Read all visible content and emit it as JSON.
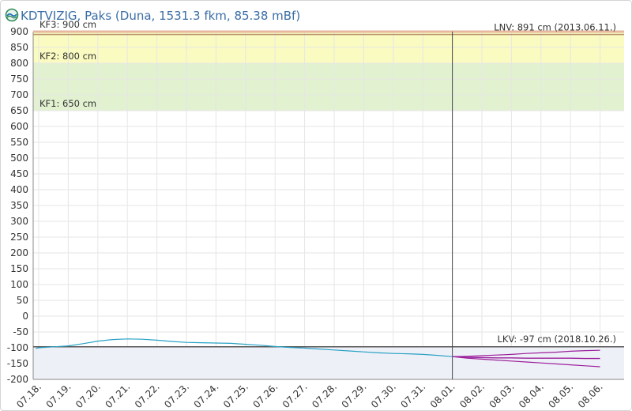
{
  "header": {
    "title": "KDTVIZIG, Paks (Duna, 1531.3 fkm, 85.38 mBf)"
  },
  "colors": {
    "kf3_band": "#f3d9c9",
    "kf2_band": "#fafbc0",
    "kf1_band": "#e2f1cf",
    "lnv_line": "#b8906a",
    "lkv_line": "#555555",
    "lkv_fill": "#eef0f8",
    "observed_line": "#27a2c4",
    "forecast_line": "#9b1f9b",
    "grid": "#e6e6e6",
    "title": "#3a6ea5"
  },
  "chart_data": {
    "type": "line",
    "ylim": [
      -200,
      900
    ],
    "ytick_step": 50,
    "yticks": [
      "900",
      "850",
      "800",
      "750",
      "700",
      "650",
      "600",
      "550",
      "500",
      "450",
      "400",
      "350",
      "300",
      "250",
      "200",
      "150",
      "100",
      "50",
      "0",
      "-50",
      "-100",
      "-150",
      "-200"
    ],
    "categories": [
      "07.18.",
      "07.19.",
      "07.20.",
      "07.21.",
      "07.22.",
      "07.23.",
      "07.24.",
      "07.25.",
      "07.26.",
      "07.27.",
      "07.28.",
      "07.29.",
      "07.30.",
      "07.31.",
      "08.01.",
      "08.02.",
      "08.03.",
      "08.04.",
      "08.05.",
      "08.06."
    ],
    "forecast_start_index": 14,
    "thresholds": [
      {
        "label": "KF1: 650 cm",
        "value": 650
      },
      {
        "label": "KF2: 800 cm",
        "value": 800
      },
      {
        "label": "KF3: 900 cm",
        "value": 900
      }
    ],
    "lnv": {
      "label": "LNV: 891 cm (2013.06.11.)",
      "value": 891
    },
    "lkv": {
      "label": "LKV: -97 cm (2018.10.26.)",
      "value": -97
    },
    "series": [
      {
        "kind": "observed",
        "x": [
          -0.1,
          0.0,
          0.5,
          1.0,
          1.5,
          2.0,
          2.5,
          3.0,
          3.5,
          4.0,
          4.5,
          5.0,
          5.5,
          6.0,
          6.5,
          7.0,
          7.5,
          8.0,
          8.5,
          9.0,
          9.5,
          10.0,
          10.5,
          11.0,
          11.5,
          12.0,
          12.5,
          13.0,
          13.5,
          14.0
        ],
        "values": [
          -102,
          -100,
          -97,
          -94,
          -87,
          -79,
          -74,
          -72,
          -73,
          -76,
          -80,
          -83,
          -84,
          -85,
          -86,
          -89,
          -92,
          -96,
          -99,
          -101,
          -104,
          -107,
          -110,
          -113,
          -116,
          -118,
          -119,
          -121,
          -124,
          -128
        ]
      },
      {
        "kind": "forecast-mid",
        "x": [
          14.0,
          14.5,
          15.0,
          15.5,
          16.0,
          16.5,
          17.0,
          17.5,
          18.0,
          18.5,
          19.0
        ],
        "values": [
          -128,
          -130,
          -131,
          -132,
          -132,
          -133,
          -133,
          -133,
          -133,
          -134,
          -134
        ]
      },
      {
        "kind": "forecast-upper",
        "x": [
          14.0,
          14.5,
          15.0,
          15.5,
          16.0,
          16.5,
          17.0,
          17.5,
          18.0,
          18.5,
          19.0
        ],
        "values": [
          -128,
          -127,
          -125,
          -123,
          -121,
          -118,
          -116,
          -114,
          -111,
          -109,
          -108
        ]
      },
      {
        "kind": "forecast-lower",
        "x": [
          14.0,
          14.5,
          15.0,
          15.5,
          16.0,
          16.5,
          17.0,
          17.5,
          18.0,
          18.5,
          19.0
        ],
        "values": [
          -128,
          -133,
          -136,
          -139,
          -142,
          -145,
          -148,
          -151,
          -154,
          -157,
          -160
        ]
      }
    ]
  }
}
